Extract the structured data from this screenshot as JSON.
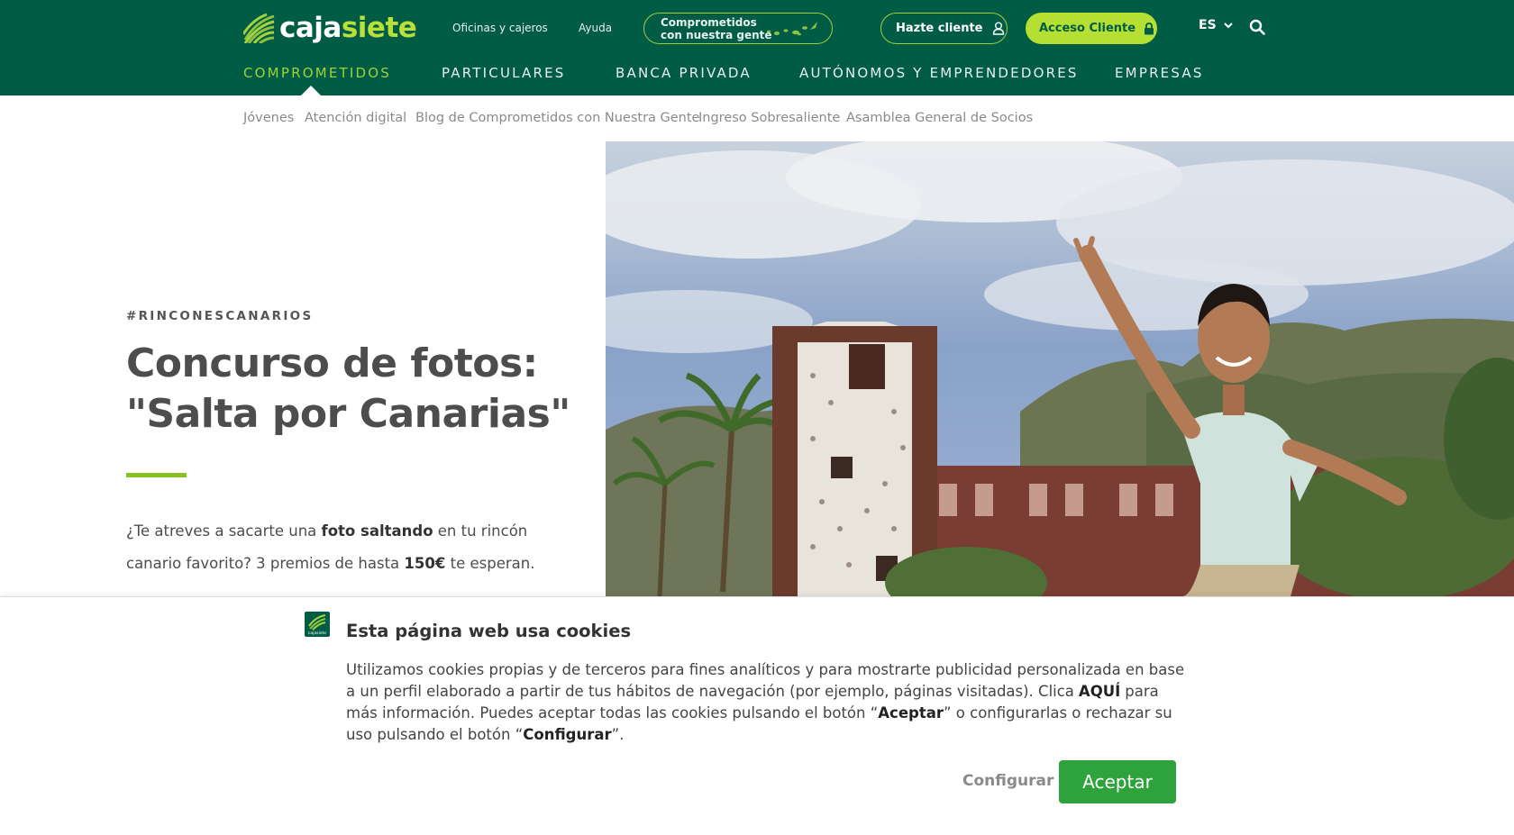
{
  "brand": {
    "logo_part1": "caja",
    "logo_part2": "siete",
    "cookie_logo_text": "cajasiete"
  },
  "toplinks": {
    "offices": "Oficinas y cajeros",
    "help": "Ayuda"
  },
  "comprometidos_badge": {
    "line1": "Comprometidos",
    "line2": "con nuestra gente"
  },
  "actions": {
    "hazte_cliente": "Hazte cliente",
    "acceso_cliente": "Acceso Cliente",
    "language": "ES"
  },
  "main_nav": [
    {
      "label": "COMPROMETIDOS",
      "active": true
    },
    {
      "label": "PARTICULARES",
      "active": false
    },
    {
      "label": "BANCA PRIVADA",
      "active": false
    },
    {
      "label": "AUTÓNOMOS Y EMPRENDEDORES",
      "active": false
    },
    {
      "label": "EMPRESAS",
      "active": false
    }
  ],
  "sub_nav": [
    {
      "label": "Jóvenes"
    },
    {
      "label": "Atención digital"
    },
    {
      "label": "Blog de Comprometidos con Nuestra Gente"
    },
    {
      "label": "Ingreso Sobresaliente"
    },
    {
      "label": "Asamblea General de Socios"
    }
  ],
  "hero": {
    "tag": "#RINCONESCANARIOS",
    "title_line1": "Concurso de fotos:",
    "title_line2": "\"Salta por Canarias\"",
    "desc_1": "¿Te atreves a sacarte una ",
    "desc_bold1": "foto saltando",
    "desc_2": " en tu rincón canario favorito? 3 premios de hasta ",
    "desc_bold2": "150€",
    "desc_3": " te esperan."
  },
  "cookie": {
    "title": "Esta página web usa cookies",
    "text_1": "Utilizamos cookies propias y de terceros para fines analíticos y para mostrarte publicidad personalizada en base a un perfil elaborado a partir de tus hábitos de navegación (por ejemplo, páginas visitadas). Clica",
    "link": "AQUÍ",
    "text_2": "para más información. Puedes aceptar todas las cookies pulsando el botón “",
    "bold_accept": "Aceptar",
    "text_3": "” o configurarlas o rechazar su uso pulsando el botón “",
    "bold_config": "Configurar",
    "text_4": "”.",
    "btn_config": "Configurar",
    "btn_accept": "Aceptar"
  },
  "colors": {
    "header_bg": "#005c45",
    "accent_green": "#b5e033",
    "accept_btn": "#2ea33c"
  },
  "icons": {
    "user": "user-icon",
    "lock": "lock-icon",
    "chevron": "chevron-down-icon",
    "search": "search-icon"
  }
}
